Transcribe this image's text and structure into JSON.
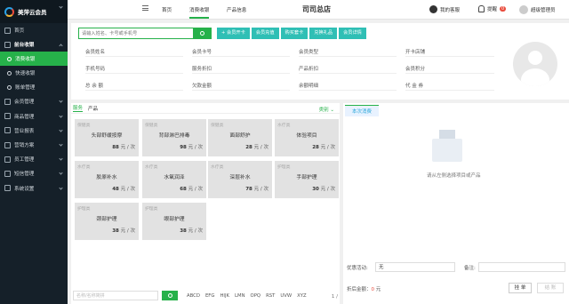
{
  "sidebar": {
    "brand": "美萍云会员",
    "items": [
      {
        "label": "首页"
      },
      {
        "label": "前台收银"
      },
      {
        "label": "消费收银"
      },
      {
        "label": "快速收银"
      },
      {
        "label": "账单管理"
      },
      {
        "label": "会员管理"
      },
      {
        "label": "商品管理"
      },
      {
        "label": "营业报表"
      },
      {
        "label": "营销方案"
      },
      {
        "label": "员工管理"
      },
      {
        "label": "短信管理"
      },
      {
        "label": "系统设置"
      }
    ]
  },
  "topbar": {
    "tabs": [
      "首页",
      "消费收银",
      "产品信息"
    ],
    "store": "司司总店",
    "service": "我的客服",
    "reminder": "提醒",
    "reminder_count": "0",
    "user": "超级管理员"
  },
  "member": {
    "search_placeholder": "请输入姓名、卡号或手机号",
    "buttons": [
      "会员开卡",
      "会员充值",
      "购买套卡",
      "兑换礼品",
      "会员详情"
    ],
    "fields": [
      "会员姓名",
      "会员卡号",
      "会员类型",
      "开卡店铺",
      "手机号码",
      "服务折扣",
      "产品折扣",
      "会员积分",
      "总 余 额",
      "欠款金额",
      "余额明细",
      "代 金 券"
    ]
  },
  "services": {
    "tabs": [
      "服务",
      "产品"
    ],
    "category_label": "类别",
    "unit": "元 / 次",
    "cards": [
      {
        "type": "保健类",
        "name": "头部舒缓按摩",
        "price": "88"
      },
      {
        "type": "保健类",
        "name": "背部淋巴排毒",
        "price": "98"
      },
      {
        "type": "保健类",
        "name": "面部舒护",
        "price": "28"
      },
      {
        "type": "水疗类",
        "name": "体验项目",
        "price": "28"
      },
      {
        "type": "水疗类",
        "name": "胶原补水",
        "price": "48"
      },
      {
        "type": "水疗类",
        "name": "水氧润泽",
        "price": "68"
      },
      {
        "type": "水疗类",
        "name": "深层补水",
        "price": "78"
      },
      {
        "type": "护理类",
        "name": "手部护理",
        "price": "30"
      },
      {
        "type": "护理类",
        "name": "颈部护理",
        "price": "38"
      },
      {
        "type": "护理类",
        "name": "眼部护理",
        "price": "38"
      }
    ],
    "search_placeholder": "名称/名称简拼",
    "letters": [
      "ABCD",
      "EFG",
      "HIJK",
      "LMN",
      "OPQ",
      "RST",
      "UVW",
      "XYZ"
    ],
    "page": "1 /"
  },
  "consume": {
    "tab": "本次消费",
    "empty_text": "请从左侧选择项目或产品",
    "discount_label": "优惠活动:",
    "discount_value": "无",
    "remark_label": "备注:",
    "amount_label": "折后金额：",
    "amount_value": "0",
    "amount_unit": "元",
    "hang_button": "挂 单",
    "pay_button": "结 账"
  },
  "colors": {
    "accent": "#26b14a",
    "teal": "#2fbfb5",
    "sidebar": "#152029"
  }
}
